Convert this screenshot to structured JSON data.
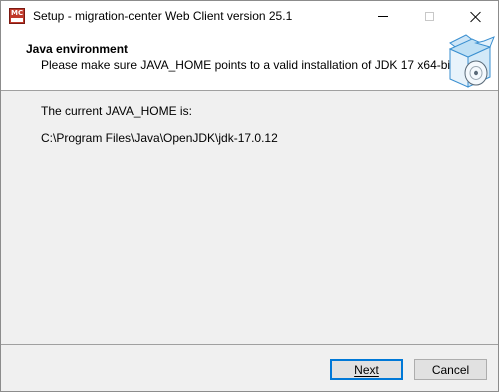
{
  "window": {
    "title": "Setup - migration-center Web Client version 25.1",
    "icon": "migration-center-app-icon",
    "icon_text": "MC",
    "controls": [
      "minimize",
      "maximize",
      "close"
    ]
  },
  "header": {
    "title": "Java environment",
    "subtitle": "Please make sure JAVA_HOME points to a valid installation of JDK 17 x64-bit!",
    "image": "installer-box-icon"
  },
  "content": {
    "java_home_label": "The current JAVA_HOME is:",
    "java_home_path": "C:\\Program Files\\Java\\OpenJDK\\jdk-17.0.12"
  },
  "buttons": {
    "next_label": "Next",
    "cancel_label": "Cancel"
  },
  "colors": {
    "accent": "#0078d7",
    "icon_red": "#c0392b"
  }
}
